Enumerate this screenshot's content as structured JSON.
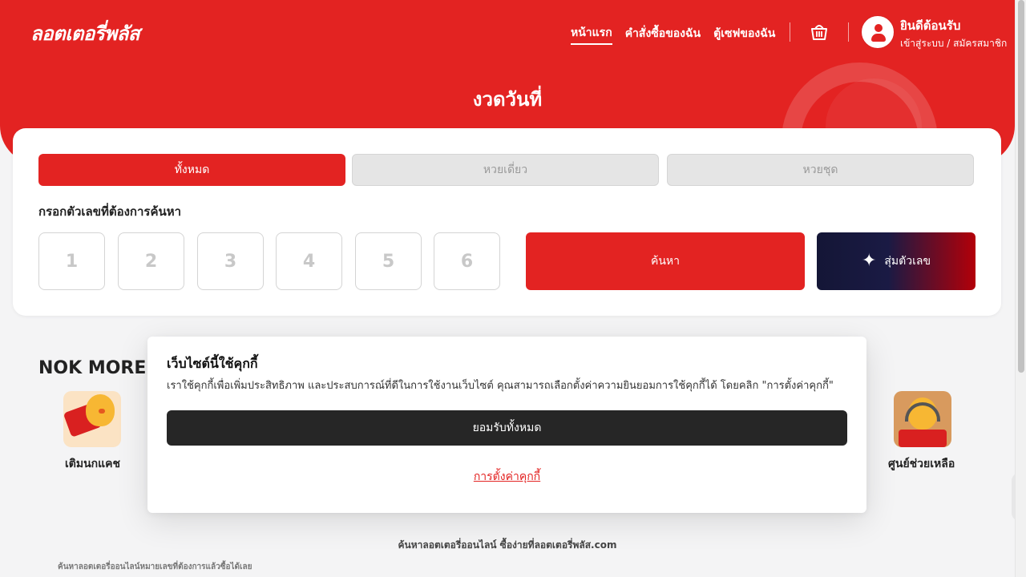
{
  "brand": {
    "logo_text": "ลอตเตอรี่พลัส",
    "primary_color": "#e32322",
    "dark_button_color": "#262626"
  },
  "header": {
    "nav": [
      {
        "label": "หน้าแรก",
        "active": true
      },
      {
        "label": "คำสั่งซื้อของฉัน",
        "active": false
      },
      {
        "label": "ตู้เซฟของฉัน",
        "active": false
      }
    ],
    "cart_icon": "basket-icon",
    "user_icon": "user-icon",
    "welcome": "ยินดีต้อนรับ",
    "login_link": "เข้าสู่ระบบ / สมัครสมาชิก"
  },
  "hero": {
    "draw_title": "งวดวันที่"
  },
  "search": {
    "tabs": [
      {
        "label": "ทั้งหมด",
        "selected": true
      },
      {
        "label": "หวยเดี่ยว",
        "selected": false
      },
      {
        "label": "หวยชุด",
        "selected": false
      }
    ],
    "prompt": "กรอกตัวเลขที่ต้องการค้นหา",
    "digit_placeholders": [
      "1",
      "2",
      "3",
      "4",
      "5",
      "6"
    ],
    "search_button": "ค้นหา",
    "random_button": "สุ่มตัวเลข",
    "random_icon": "sparkle-icon"
  },
  "nok_more": {
    "title": "NOK MORE",
    "items": [
      {
        "label": "เติมนกแคช",
        "icon": "mascot-topup-icon"
      },
      {
        "label": "ศูนย์ช่วยเหลือ",
        "icon": "mascot-helpcenter-icon"
      }
    ]
  },
  "cookie_banner": {
    "title": "เว็บไซต์นี้ใช้คุกกี้",
    "text": "เราใช้คุกกี้เพื่อเพิ่มประสิทธิภาพ และประสบการณ์ที่ดีในการใช้งานเว็บไซต์ คุณสามารถเลือกตั้งค่าความยินยอมการใช้คุกกี้ได้ โดยคลิก \"การตั้งค่าคุกกี้\"",
    "accept_button": "ยอมรับทั้งหมด",
    "settings_link": "การตั้งค่าคุกกี้"
  },
  "footer": {
    "tagline": "ค้นหาลอตเตอรี่ออนไลน์ ซื้อง่ายที่ลอตเตอรี่พลัส.com",
    "small_text": "ค้นหาลอตเตอรี่ออนไลน์หมายเลขที่ต้องการแล้วซื้อได้เลย"
  }
}
